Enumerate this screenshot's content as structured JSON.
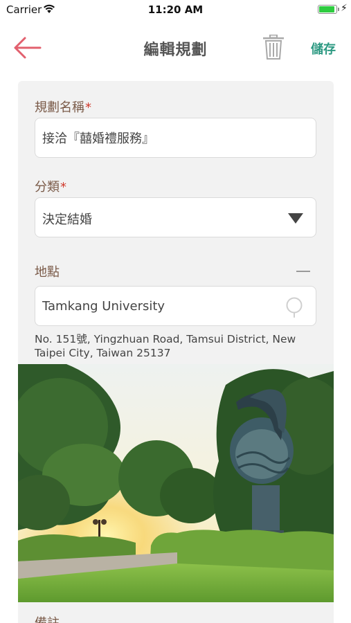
{
  "status_bar": {
    "carrier": "Carrier",
    "time": "11:20 AM"
  },
  "nav": {
    "title": "編輯規劃",
    "save_label": "儲存"
  },
  "form": {
    "name_label": "規劃名稱",
    "required_mark": "*",
    "name_value": "接洽『囍婚禮服務』",
    "category_label": "分類",
    "category_value": "決定結婚",
    "location_label": "地點",
    "location_value": "Tamkang University",
    "address": "No. 151號, Yingzhuan Road, Tamsui District, New Taipei City, Taiwan 25137",
    "next_label": "備註"
  },
  "colors": {
    "accent": "#2e9a83",
    "back_arrow": "#e2606e",
    "label": "#7a5a48",
    "required": "#d0392b",
    "battery": "#2ecc40"
  },
  "icons": {
    "back": "arrow-left-icon",
    "trash": "trash-icon",
    "dropdown": "triangle-down-icon",
    "pin": "map-pin-icon",
    "collapse": "minus-icon"
  },
  "battery_level": 1.0
}
